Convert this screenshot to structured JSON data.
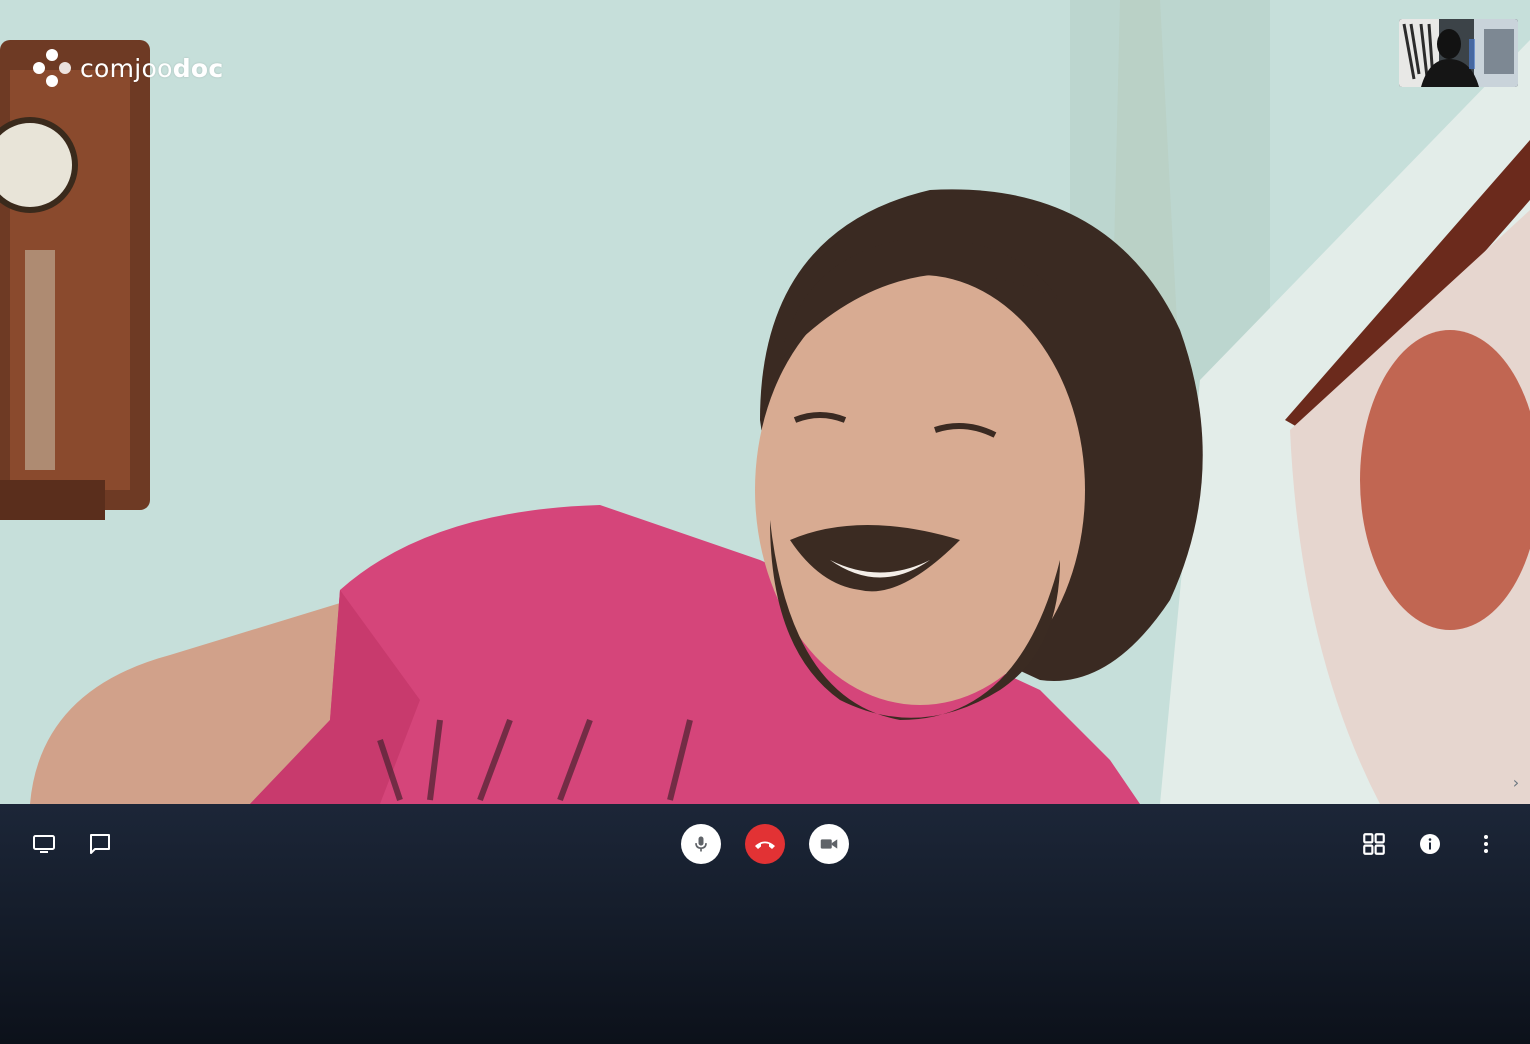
{
  "app": {
    "logo_light": "comjoo",
    "logo_bold": "doc"
  },
  "colors": {
    "toolbar_top": "#1c2638",
    "toolbar_bottom": "#0c111a",
    "hangup_red": "#e23234",
    "button_white": "#ffffff",
    "icon_white": "#ffffff",
    "icon_gray": "#5f6368"
  },
  "toolbar": {
    "left": [
      {
        "icon": "screen-share-icon"
      },
      {
        "icon": "chat-icon"
      }
    ],
    "center": [
      {
        "icon": "microphone-icon"
      },
      {
        "icon": "hang-up-icon"
      },
      {
        "icon": "camera-icon"
      }
    ],
    "right": [
      {
        "icon": "grid-view-icon"
      },
      {
        "icon": "info-icon"
      },
      {
        "icon": "more-options-icon"
      }
    ]
  },
  "filmstrip": {
    "toggle_icon": "chevron-right-icon",
    "toggle_glyph": "›"
  }
}
